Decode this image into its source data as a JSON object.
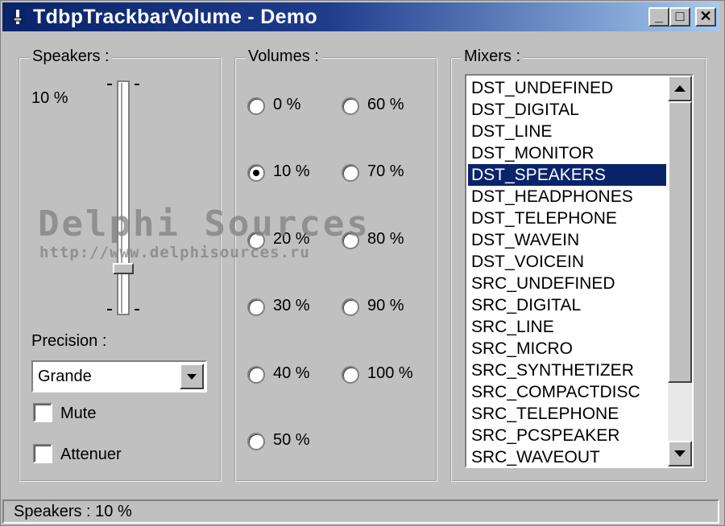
{
  "window": {
    "title": "TdbpTrackbarVolume - Demo",
    "minimize_glyph": "_",
    "maximize_glyph": "□",
    "close_glyph": "✕"
  },
  "speakers": {
    "legend": "Speakers :",
    "value_text": "10 %",
    "trackbar_level": 0.1,
    "precision_label": "Precision :",
    "precision_value": "Grande",
    "mute_label": "Mute",
    "mute_checked": false,
    "attenuer_label": "Attenuer",
    "attenuer_checked": false
  },
  "volumes": {
    "legend": "Volumes :",
    "options": [
      {
        "label": "0 %",
        "checked": false
      },
      {
        "label": "10 %",
        "checked": true
      },
      {
        "label": "20 %",
        "checked": false
      },
      {
        "label": "30 %",
        "checked": false
      },
      {
        "label": "40 %",
        "checked": false
      },
      {
        "label": "50 %",
        "checked": false
      },
      {
        "label": "60 %",
        "checked": false
      },
      {
        "label": "70 %",
        "checked": false
      },
      {
        "label": "80 %",
        "checked": false
      },
      {
        "label": "90 %",
        "checked": false
      },
      {
        "label": "100 %",
        "checked": false
      }
    ]
  },
  "mixers": {
    "legend": "Mixers :",
    "selected": "DST_SPEAKERS",
    "items": [
      "DST_UNDEFINED",
      "DST_DIGITAL",
      "DST_LINE",
      "DST_MONITOR",
      "DST_SPEAKERS",
      "DST_HEADPHONES",
      "DST_TELEPHONE",
      "DST_WAVEIN",
      "DST_VOICEIN",
      "SRC_UNDEFINED",
      "SRC_DIGITAL",
      "SRC_LINE",
      "SRC_MICRO",
      "SRC_SYNTHETIZER",
      "SRC_COMPACTDISC",
      "SRC_TELEPHONE",
      "SRC_PCSPEAKER",
      "SRC_WAVEOUT"
    ]
  },
  "status": {
    "text": "Speakers : 10 %"
  },
  "watermark": {
    "title": "Delphi Sources",
    "url": "http://www.delphisources.ru"
  },
  "colors": {
    "titlebar_start": "#0a246a",
    "titlebar_end": "#a6caf0",
    "selection": "#0a246a",
    "face": "#c0c0c0"
  },
  "icons": {
    "app": "app-icon",
    "dropdown": "triangle-down",
    "scroll_up": "triangle-up",
    "scroll_down": "triangle-down"
  }
}
